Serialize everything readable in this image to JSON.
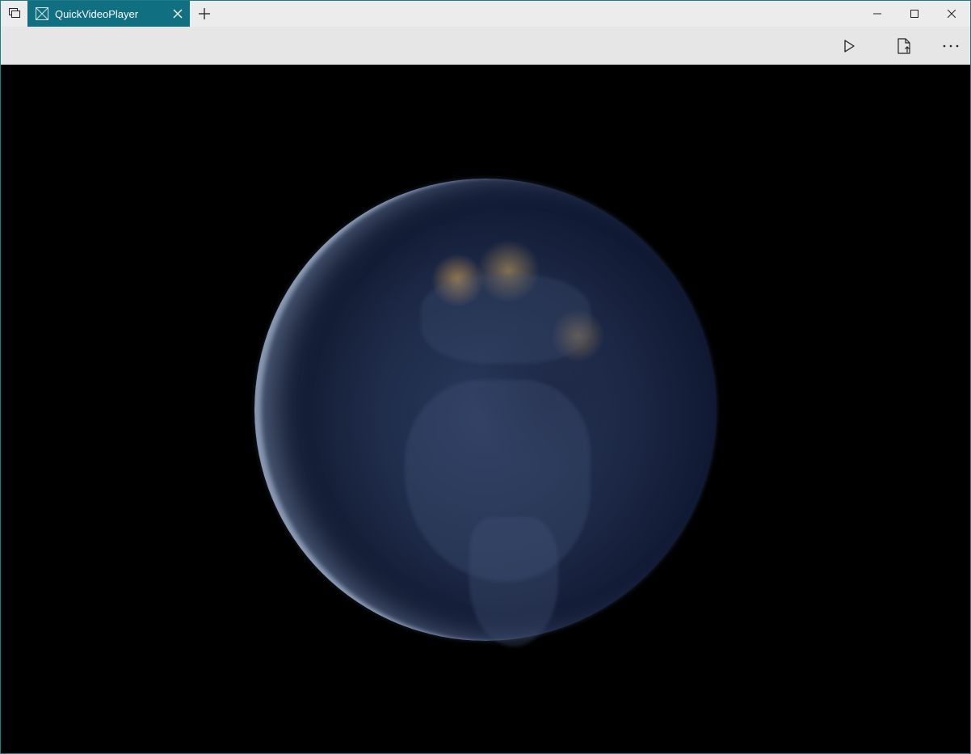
{
  "tab": {
    "title": "QuickVideoPlayer"
  },
  "icons": {
    "tab_switcher": "tab-switcher-icon",
    "tab_app": "app-placeholder-icon",
    "tab_close": "close-icon",
    "new_tab": "plus-icon",
    "minimize": "minimize-icon",
    "maximize": "maximize-icon",
    "close": "close-icon",
    "play": "play-icon",
    "open_file": "open-file-icon",
    "more": "more-icon"
  },
  "colors": {
    "tab_active": "#107082",
    "titlebar": "#ececec",
    "commandbar": "#e6e6e6",
    "video_background": "#000000",
    "window_border": "#1f7a86"
  }
}
